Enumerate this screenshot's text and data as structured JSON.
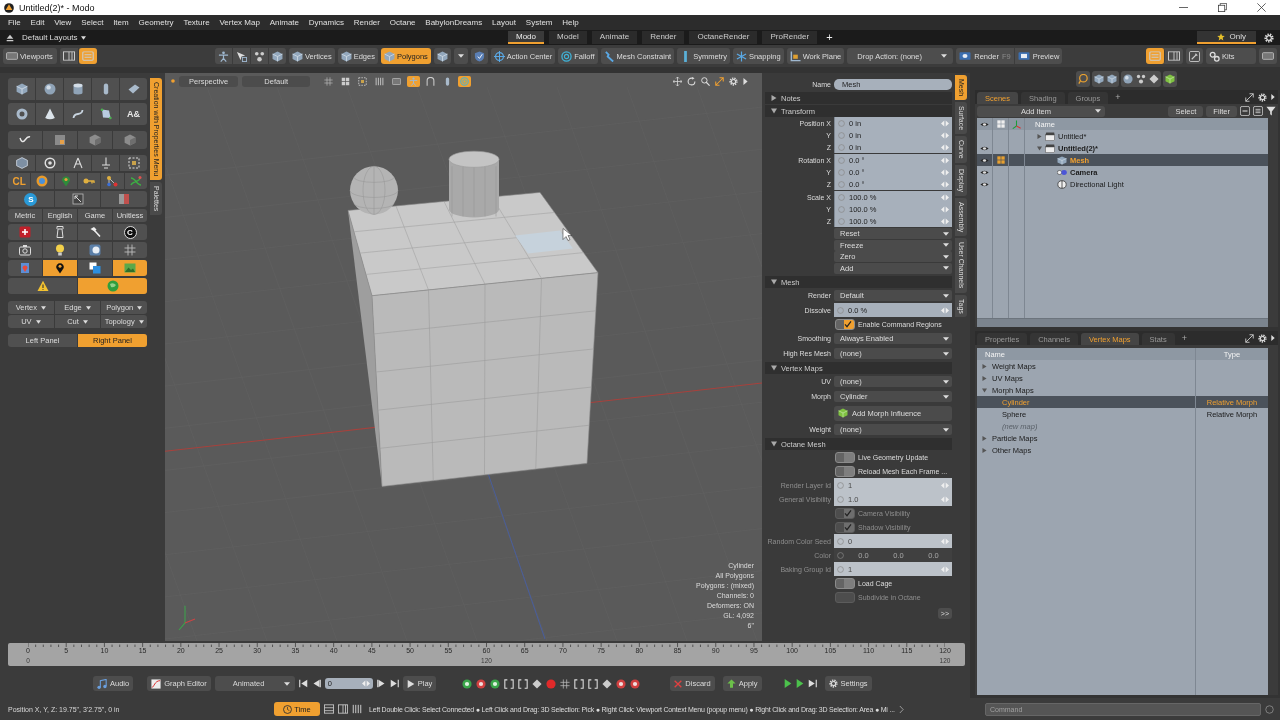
{
  "window": {
    "title": "Untitled(2)* - Modo"
  },
  "menu_bar": [
    "File",
    "Edit",
    "View",
    "Select",
    "Item",
    "Geometry",
    "Texture",
    "Vertex Map",
    "Animate",
    "Dynamics",
    "Render",
    "Octane",
    "BabylonDreams",
    "Layout",
    "System",
    "Help"
  ],
  "layout_bar": {
    "layouts_menu": "Default Layouts",
    "tabs": [
      {
        "label": "Modo",
        "selected": true
      },
      {
        "label": "Model",
        "selected": false
      },
      {
        "label": "Animate",
        "selected": false
      },
      {
        "label": "Render",
        "selected": false
      },
      {
        "label": "OctaneRender",
        "selected": false
      },
      {
        "label": "ProRender",
        "selected": false
      }
    ],
    "add_tab": "+",
    "favorites_filter": "Only"
  },
  "toolbar": {
    "viewports_button": "Viewports",
    "layout_toggles": [
      {
        "on": false
      },
      {
        "on": true
      }
    ],
    "selection_modes": [
      {
        "label": "Vertices",
        "selected": false
      },
      {
        "label": "Edges",
        "selected": false
      },
      {
        "label": "Polygons",
        "selected": true
      }
    ],
    "tools": [
      "Action Center",
      "Falloff",
      "Mesh Constraint",
      "Symmetry",
      "Snapping",
      "Work Plane"
    ],
    "drop_action": "Drop Action: (none)",
    "render_button": "Render",
    "render_shortcut": "F9",
    "preview_button": "Preview",
    "panel_toggles": [
      {
        "on": true
      },
      {
        "on": false
      }
    ],
    "kits_button": "Kits"
  },
  "left_panel": {
    "glyph_tools": [
      "A&",
      "CL",
      "S",
      "C"
    ],
    "units": [
      "Metric",
      "English",
      "Game",
      "Unitless"
    ],
    "toggle_rows": [
      [
        {
          "on": false
        },
        {
          "on": true
        },
        {
          "on": false
        },
        {
          "on": true
        }
      ],
      [
        {
          "on": false
        },
        {
          "on": true
        }
      ]
    ],
    "menus": [
      [
        "Vertex",
        "Edge",
        "Polygon"
      ],
      [
        "UV",
        "Cut",
        "Topology"
      ]
    ],
    "panel_buttons": [
      {
        "label": "Left Panel",
        "selected": false
      },
      {
        "label": "Right Panel",
        "selected": true
      }
    ],
    "side_tabs": [
      {
        "label": "Creation with Properties Menu",
        "selected": true
      },
      {
        "label": "Palettes",
        "selected": false
      }
    ]
  },
  "viewport": {
    "view_menu": "Perspective",
    "shading_menu": "Default",
    "view_toggles": [
      {
        "on": false
      },
      {
        "on": false
      },
      {
        "on": false
      },
      {
        "on": false
      },
      {
        "on": false
      },
      {
        "on": true
      },
      {
        "on": false
      },
      {
        "on": false
      },
      {
        "on": true
      }
    ],
    "info": [
      "Cylinder",
      "All Polygons",
      "Polygons : (mixed)",
      "Channels: 0",
      "Deformers: ON",
      "GL: 4,092",
      "6\""
    ]
  },
  "properties": {
    "name_label": "Name",
    "name_value": "Mesh",
    "sections": [
      {
        "title": "Notes",
        "expanded": false
      },
      {
        "title": "Transform",
        "expanded": true,
        "rows": [
          {
            "kind": "vector",
            "labels": [
              "Position X",
              "Y",
              "Z"
            ],
            "values": [
              "0 in",
              "0 in",
              "0 in"
            ],
            "disabled": false
          },
          {
            "kind": "vector",
            "labels": [
              "Rotation X",
              "Y",
              "Z"
            ],
            "values": [
              "0.0 °",
              "0.0 °",
              "0.0 °"
            ],
            "disabled": false
          },
          {
            "kind": "vector",
            "labels": [
              "Scale X",
              "Y",
              "Z"
            ],
            "values": [
              "100.0 %",
              "100.0 %",
              "100.0 %"
            ],
            "disabled": false
          },
          {
            "kind": "menus",
            "values": [
              "Reset",
              "Freeze",
              "Zero",
              "Add"
            ],
            "disabled": false
          }
        ]
      },
      {
        "title": "Mesh",
        "expanded": true,
        "rows": [
          {
            "kind": "dropdown",
            "label": "Render",
            "value": "Default",
            "disabled": false
          },
          {
            "kind": "field",
            "label": "Dissolve",
            "value": "0.0 %",
            "disabled": false
          },
          {
            "kind": "checkbox",
            "label": "Enable Command Regions",
            "checked": true,
            "disabled": false
          },
          {
            "kind": "dropdown",
            "label": "Smoothing",
            "value": "Always Enabled",
            "disabled": false
          },
          {
            "kind": "dropdown",
            "label": "High Res Mesh",
            "value": "(none)",
            "disabled": false
          }
        ]
      },
      {
        "title": "Vertex Maps",
        "expanded": true,
        "rows": [
          {
            "kind": "dropdown",
            "label": "UV",
            "value": "(none)",
            "disabled": false
          },
          {
            "kind": "dropdown",
            "label": "Morph",
            "value": "Cylinder",
            "disabled": false
          },
          {
            "kind": "button",
            "value": "Add Morph Influence",
            "disabled": false
          },
          {
            "kind": "dropdown",
            "label": "Weight",
            "value": "(none)",
            "disabled": false
          }
        ]
      },
      {
        "title": "Octane Mesh",
        "expanded": true,
        "rows": [
          {
            "kind": "checkbox",
            "label": "Live Geometry Update",
            "checked": false,
            "disabled": false
          },
          {
            "kind": "checkbox",
            "label": "Reload Mesh Each Frame ...",
            "checked": false,
            "disabled": false
          },
          {
            "kind": "field",
            "label": "Render Layer Id",
            "value": "1",
            "disabled": true
          },
          {
            "kind": "field",
            "label": "General Visibility",
            "value": "1.0",
            "disabled": true
          },
          {
            "kind": "checkbox",
            "label": "Camera Visibility",
            "checked": true,
            "disabled": true
          },
          {
            "kind": "checkbox",
            "label": "Shadow Visibility",
            "checked": true,
            "disabled": true
          },
          {
            "kind": "field",
            "label": "Random Color Seed",
            "value": "0",
            "disabled": true
          },
          {
            "kind": "color",
            "label": "Color",
            "values": [
              "0.0",
              "0.0",
              "0.0"
            ],
            "disabled": true
          },
          {
            "kind": "field",
            "label": "Baking Group Id",
            "value": "1",
            "disabled": true
          },
          {
            "kind": "checkbox",
            "label": "Load Cage",
            "checked": false,
            "disabled": false
          },
          {
            "kind": "checkbox",
            "label": "Subdivide in Octane",
            "checked": false,
            "disabled": true
          }
        ]
      }
    ],
    "more_button": ">>",
    "side_tabs": [
      {
        "label": "Mesh",
        "selected": true
      },
      {
        "label": "Surface",
        "selected": false
      },
      {
        "label": "Curve",
        "selected": false
      },
      {
        "label": "Display",
        "selected": false
      },
      {
        "label": "Assembly",
        "selected": false
      },
      {
        "label": "User Channels",
        "selected": false
      },
      {
        "label": "Tags",
        "selected": false
      }
    ]
  },
  "scenes_panel": {
    "tabs": [
      {
        "label": "Scenes",
        "selected": true
      },
      {
        "label": "Shading",
        "selected": false
      },
      {
        "label": "Groups",
        "selected": false
      }
    ],
    "add_tab": "+",
    "add_item": "Add Item",
    "buttons": [
      "Select",
      "Filter"
    ],
    "column": "Name",
    "items": [
      {
        "kind": "scene",
        "label": "Untitled*",
        "expanded": false,
        "selected": false,
        "active": false,
        "visible": false
      },
      {
        "kind": "scene",
        "label": "Untitled(2)*",
        "expanded": true,
        "selected": false,
        "active": true,
        "visible": true,
        "children": [
          {
            "kind": "mesh",
            "label": "Mesh",
            "selected": true,
            "active": false,
            "visible": true
          },
          {
            "kind": "camera",
            "label": "Camera",
            "selected": false,
            "active": true,
            "visible": true
          },
          {
            "kind": "light",
            "label": "Directional Light",
            "selected": false,
            "active": false,
            "visible": true
          }
        ]
      }
    ]
  },
  "vertex_maps_panel": {
    "tabs": [
      {
        "label": "Properties",
        "selected": false
      },
      {
        "label": "Channels",
        "selected": false
      },
      {
        "label": "Vertex Maps",
        "selected": true
      },
      {
        "label": "Stats",
        "selected": false
      }
    ],
    "add_tab": "+",
    "columns": [
      "Name",
      "Type"
    ],
    "items": [
      {
        "label": "Weight Maps",
        "expanded": false
      },
      {
        "label": "UV Maps",
        "expanded": false
      },
      {
        "label": "Morph Maps",
        "expanded": true,
        "children": [
          {
            "label": "Cylinder",
            "type": "Relative Morph",
            "selected": true,
            "disabled": false
          },
          {
            "label": "Sphere",
            "type": "Relative Morph",
            "selected": false,
            "disabled": false
          },
          {
            "label": "(new map)",
            "selected": false,
            "disabled": true
          }
        ]
      },
      {
        "label": "Particle Maps",
        "expanded": false
      },
      {
        "label": "Other Maps",
        "expanded": false
      }
    ]
  },
  "timeline": {
    "ticks": [
      "0",
      "5",
      "10",
      "15",
      "20",
      "25",
      "30",
      "35",
      "40",
      "45",
      "50",
      "55",
      "60",
      "65",
      "70",
      "75",
      "80",
      "85",
      "90",
      "95",
      "100",
      "105",
      "110",
      "115",
      "120"
    ],
    "range_labels": [
      "0",
      "120",
      "120"
    ]
  },
  "transport": {
    "audio": "Audio",
    "graph_editor": "Graph Editor",
    "key_mode": "Animated",
    "frame": "0",
    "play": "Play",
    "discard": "Discard",
    "apply": "Apply",
    "settings": "Settings"
  },
  "status_bar": {
    "position": "Position X, Y, Z:  19.75\", 3'2.75\", 0 in",
    "time_button": {
      "label": "Time",
      "selected": true
    },
    "hints": "Left Double Click: Select Connected ● Left Click and Drag: 3D Selection: Pick ● Right Click: Viewport Context Menu (popup menu) ● Right Click and Drag: 3D Selection: Area ● Mi ...",
    "command_placeholder": "Command"
  }
}
